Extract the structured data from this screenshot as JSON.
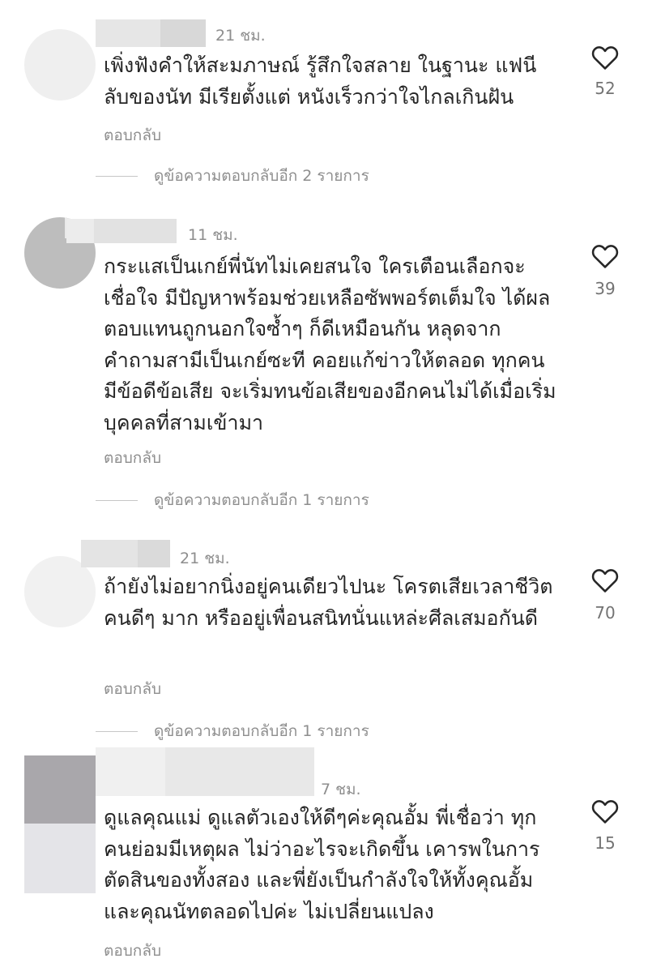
{
  "comments": [
    {
      "time": "21 ชม.",
      "text": "เพิ่งฟังคำให้สะมภาษณ์ รู้สึกใจสลาย ในฐานะ แฟนีลับของนัท มีเรียตั้งแต่ หนังเร็วกว่าใจไกลเกินฝัน",
      "reply_label": "ตอบกลับ",
      "likes": "52",
      "view_replies": "ดูข้อความตอบกลับอีก 2 รายการ"
    },
    {
      "time": "11 ชม.",
      "text": "กระแสเป็นเกย์พี่นัทไม่เคยสนใจ ใครเตือนเลือกจะเชื่อใจ มีปัญหาพร้อมช่วยเหลือซัพพอร์ตเต็มใจ ได้ผลตอบแทนถูกนอกใจซ้ำๆ ก็ดีเหมือนกัน หลุดจากคำถามสามีเป็นเกย์ซะที คอยแก้ข่าวให้ตลอด ทุกคนมีข้อดีข้อเสีย จะเริ่มทนข้อเสียของอีกคนไม่ได้เมื่อเริ่มบุคคลที่สามเข้ามา",
      "reply_label": "ตอบกลับ",
      "likes": "39",
      "view_replies": "ดูข้อความตอบกลับอีก 1 รายการ"
    },
    {
      "time": "21 ชม.",
      "text": "ถ้ายังไม่อยากนิ่งอยู่คนเดียวไปนะ โครตเสียเวลาชีวิตคนดีๆ มาก หรืออยู่เพื่อนสนิทนั่นแหล่ะศีลเสมอกันดี",
      "reply_label": "ตอบกลับ",
      "likes": "70",
      "view_replies": "ดูข้อความตอบกลับอีก 1 รายการ"
    },
    {
      "time": "7 ชม.",
      "text": "ดูแลคุณแม่ ดูแลตัวเองให้ดีๆค่ะคุณอั้ม พี่เชื่อว่า ทุกคนย่อมมีเหตุผล ไม่ว่าอะไรจะเกิดขึ้น เคารพในการตัดสินของทั้งสอง และพี่ยังเป็นกำลังใจให้ทั้งคุณอั้ม และคุณนัทตลอดไปค่ะ ไม่เปลี่ยนแปลง",
      "reply_label": "ตอบกลับ",
      "likes": "15"
    }
  ]
}
